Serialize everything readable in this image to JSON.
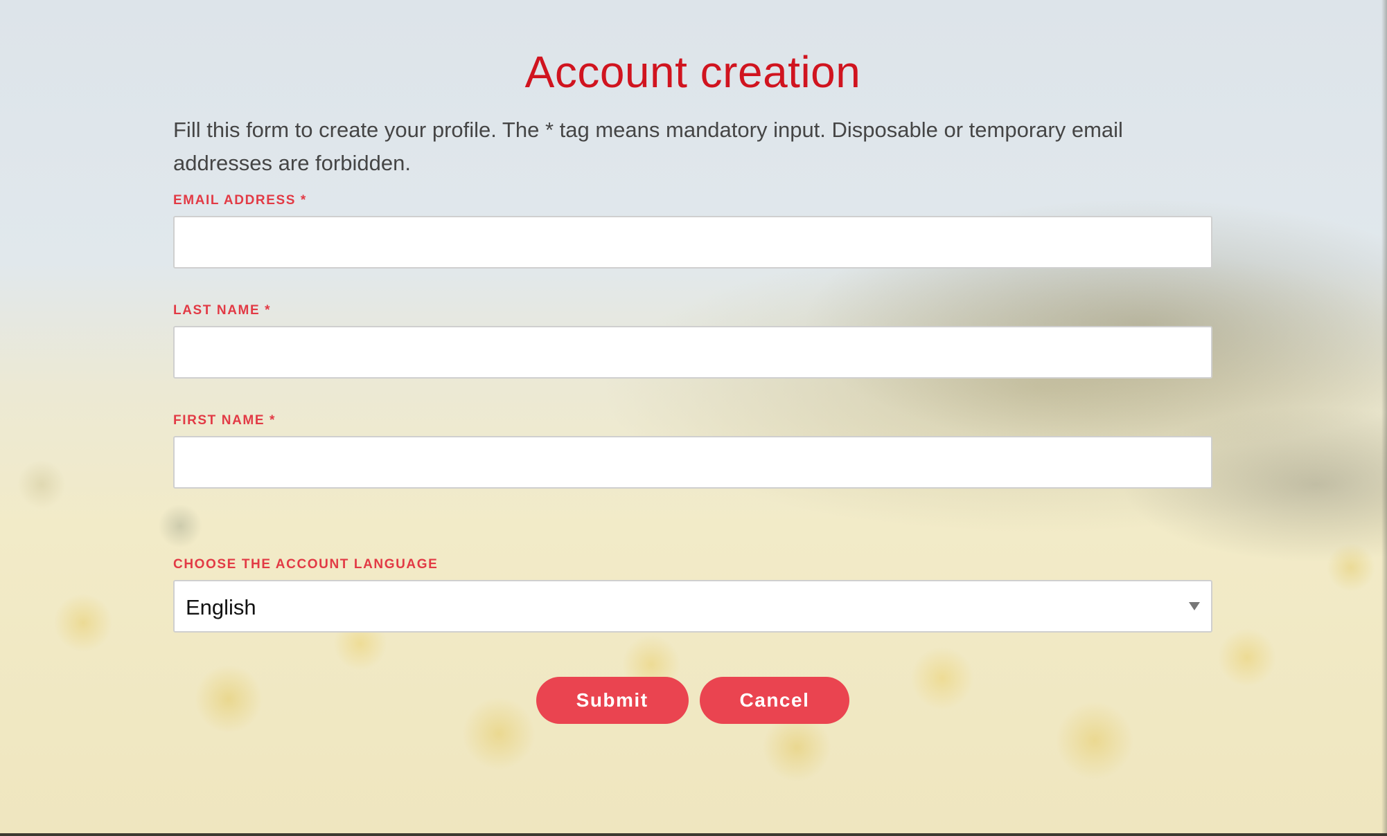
{
  "page": {
    "title": "Account creation",
    "intro": "Fill this form to create your profile. The * tag means mandatory input. Disposable or temporary email addresses are forbidden."
  },
  "form": {
    "email": {
      "label": "EMAIL ADDRESS *",
      "value": ""
    },
    "last_name": {
      "label": "LAST NAME *",
      "value": ""
    },
    "first_name": {
      "label": "FIRST NAME *",
      "value": ""
    },
    "language": {
      "label": "CHOOSE THE ACCOUNT LANGUAGE",
      "selected": "English"
    }
  },
  "actions": {
    "submit_label": "Submit",
    "cancel_label": "Cancel"
  },
  "colors": {
    "title": "#d0141f",
    "label": "#e23a45",
    "button": "#ea4450"
  },
  "icons": {
    "dropdown": "chevron-down-icon"
  }
}
